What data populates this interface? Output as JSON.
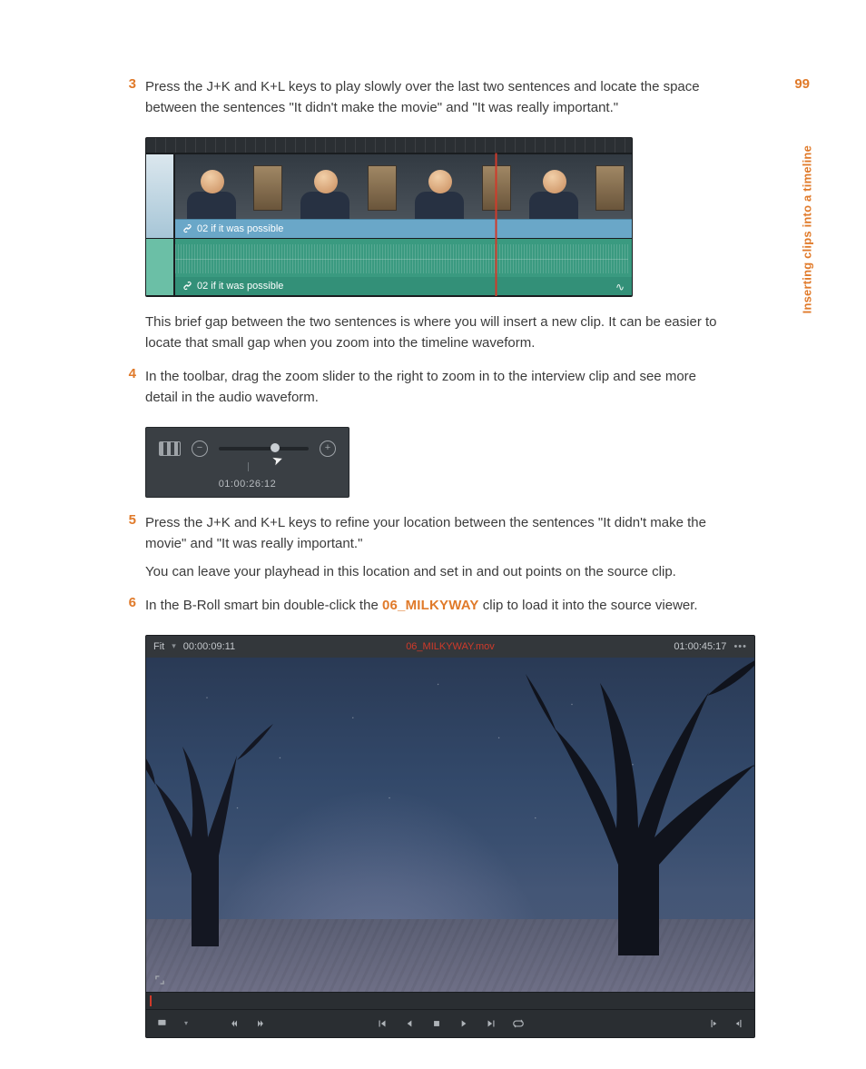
{
  "page_number": "99",
  "section_label": "Inserting clips into a timeline",
  "steps": {
    "s3": {
      "num": "3",
      "text": "Press the J+K and K+L keys to play slowly over the last two sentences and locate the space between the sentences \"It didn't make the movie\" and \"It was really important.\"",
      "after": "This brief gap between the two sentences is where you will insert a new clip. It can be easier to locate that small gap when you zoom into the timeline waveform."
    },
    "s4": {
      "num": "4",
      "text": "In the toolbar, drag the zoom slider to the right to zoom in to the interview clip and see more detail in the audio waveform."
    },
    "s5": {
      "num": "5",
      "text": "Press the J+K and K+L keys to refine your location between the sentences \"It didn't make the movie\" and \"It was really important.\"",
      "text2": "You can leave your playhead in this location and set in and out points on the source clip."
    },
    "s6": {
      "num": "6",
      "text_a": "In the B-Roll smart bin double-click the ",
      "clip_name": "06_MILKYWAY",
      "text_b": " clip to load it into the source viewer."
    }
  },
  "timeline": {
    "video_clip_label": "02 if it was possible",
    "audio_clip_label": "02 if it was possible"
  },
  "zoom": {
    "timecode": "01:00:26:12",
    "minus": "−",
    "plus": "+"
  },
  "viewer": {
    "fit": "Fit",
    "duration": "00:00:09:11",
    "title": "06_MILKYWAY.mov",
    "timecode": "01:00:45:17",
    "dots": "•••"
  }
}
